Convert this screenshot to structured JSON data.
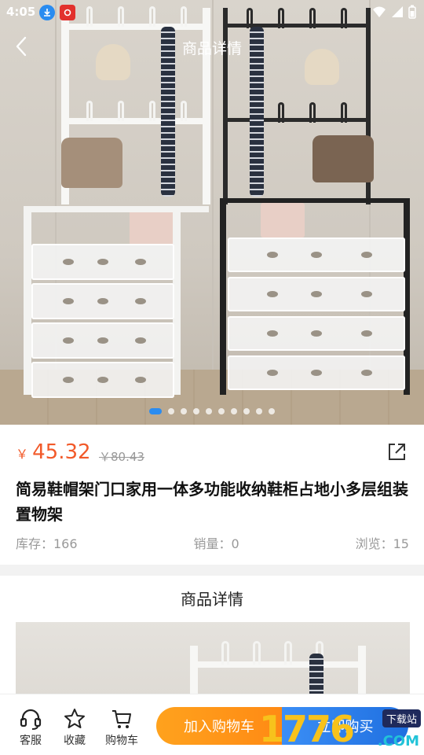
{
  "status_bar": {
    "time": "4:05",
    "icons": [
      "download-badge-icon",
      "app-badge-icon",
      "wifi-icon",
      "signal-icon",
      "battery-icon"
    ]
  },
  "nav": {
    "title": "商品详情",
    "back_icon": "chevron-left-icon"
  },
  "carousel": {
    "total": 10,
    "active_index": 0
  },
  "product": {
    "currency": "￥",
    "price": "45.32",
    "original_price": "￥80.43",
    "title": "简易鞋帽架门口家用一体多功能收纳鞋柜占地小多层组装置物架",
    "stats": {
      "stock": "库存：166",
      "sales": "销量：0",
      "views": "浏览：15"
    }
  },
  "detail": {
    "heading": "商品详情"
  },
  "bottom_bar": {
    "service_label": "客服",
    "favorite_label": "收藏",
    "cart_label": "购物车",
    "add_to_cart_label": "加入购物车",
    "buy_now_label": "立即购买"
  },
  "watermark": {
    "digits": "1776",
    "tag": "下载站",
    "suffix": ".COM"
  },
  "colors": {
    "price": "#f25a2a",
    "add_to_cart": "#ff9a1a",
    "buy_now": "#2a7ff0",
    "carousel_active": "#2a8cf0"
  }
}
